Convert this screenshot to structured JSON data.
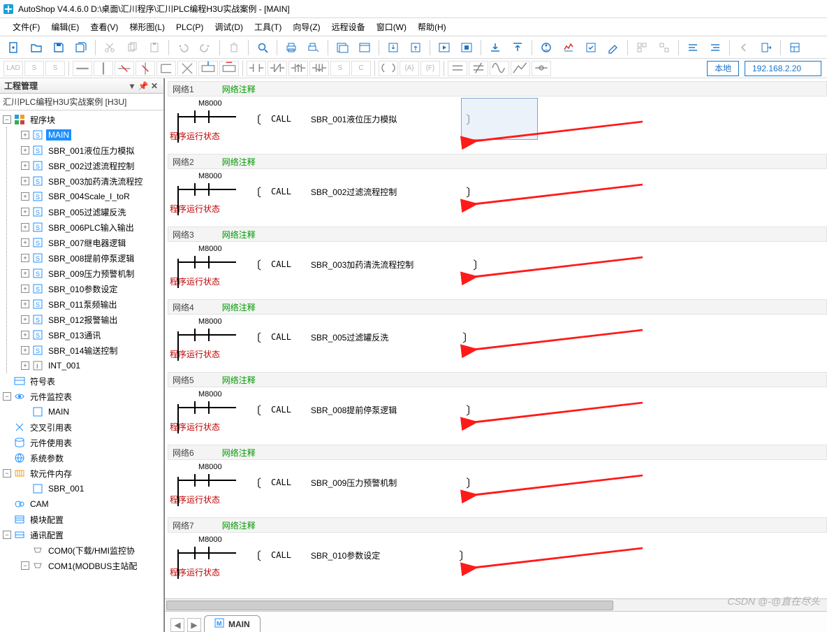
{
  "title": "AutoShop V4.4.6.0  D:\\桌面\\汇川程序\\汇川PLC编程H3U实战案例 - [MAIN]",
  "menu": [
    "文件(F)",
    "编辑(E)",
    "查看(V)",
    "梯形图(L)",
    "PLC(P)",
    "调试(D)",
    "工具(T)",
    "向导(Z)",
    "远程设备",
    "窗口(W)",
    "帮助(H)"
  ],
  "toolbar2_labels": [
    "LAD",
    "S",
    "S"
  ],
  "conn_mode": "本地",
  "ip": "192.168.2.20",
  "panel_title": "工程管理",
  "project_name": "汇川PLC编程H3U实战案例 [H3U]",
  "tree": {
    "program_block": "程序块",
    "subs": [
      "MAIN",
      "SBR_001液位压力模拟",
      "SBR_002过滤流程控制",
      "SBR_003加药清洗流程控",
      "SBR_004Scale_I_toR",
      "SBR_005过滤罐反洗",
      "SBR_006PLC输入输出",
      "SBR_007继电器逻辑",
      "SBR_008提前停泵逻辑",
      "SBR_009压力预警机制",
      "SBR_010参数设定",
      "SBR_011泵频输出",
      "SBR_012报警输出",
      "SBR_013通讯",
      "SBR_014输送控制"
    ],
    "int": "INT_001",
    "symbol_table": "符号表",
    "element_watch": "元件监控表",
    "watch_child": "MAIN",
    "xref": "交叉引用表",
    "usage": "元件使用表",
    "sysparam": "系统参数",
    "softmem": "软元件内存",
    "softmem_child": "SBR_001",
    "cam": "CAM",
    "modcfg": "模块配置",
    "commcfg": "通讯配置",
    "com0": "COM0(下载/HMI监控协",
    "com1": "COM1(MODBUS主站配"
  },
  "net_comment": "网络注释",
  "contact_dev": "M8000",
  "run_status": "程序运行状态",
  "call_op": "CALL",
  "networks": [
    {
      "name": "网络1",
      "arg": "SBR_001液位压力模拟"
    },
    {
      "name": "网络2",
      "arg": "SBR_002过滤流程控制"
    },
    {
      "name": "网络3",
      "arg": "SBR_003加药清洗流程控制"
    },
    {
      "name": "网络4",
      "arg": "SBR_005过滤罐反洗"
    },
    {
      "name": "网络5",
      "arg": "SBR_008提前停泵逻辑"
    },
    {
      "name": "网络6",
      "arg": "SBR_009压力预警机制"
    },
    {
      "name": "网络7",
      "arg": "SBR_010参数设定"
    }
  ],
  "tab_name": "MAIN",
  "watermark": "CSDN @-@直在尽头"
}
